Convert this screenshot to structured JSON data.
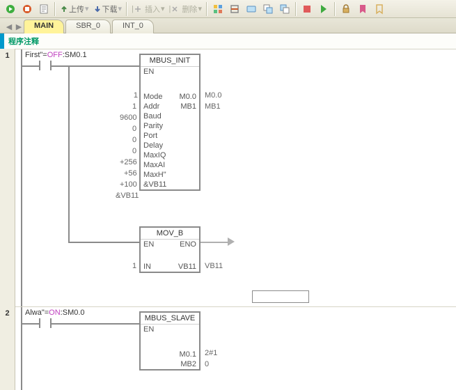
{
  "toolbar": {
    "upload_label": "上传",
    "download_label": "下载",
    "insert_label": "插入",
    "delete_label": "删除"
  },
  "tabs": {
    "main": "MAIN",
    "sbr0": "SBR_0",
    "int0": "INT_0"
  },
  "comment": "程序注释",
  "net1": {
    "number": "1",
    "label_first": "First\"=",
    "label_off": "OFF",
    "label_sm01": ":SM0.1",
    "mbus_init": {
      "title": "MBUS_INIT",
      "en": "EN",
      "pins": {
        "mode": "Mode",
        "mode_in": "1",
        "mode_out": "M0.0",
        "mode_ext": "M0.0",
        "addr": "Addr",
        "addr_in": "1",
        "addr_out": "MB1",
        "addr_ext": "MB1",
        "baud": "Baud",
        "baud_in": "9600",
        "parity": "Parity",
        "parity_in": "0",
        "port": "Port",
        "port_in": "0",
        "delay": "Delay",
        "delay_in": "0",
        "maxiq": "MaxIQ",
        "maxiq_in": "+256",
        "maxai": "MaxAI",
        "maxai_in": "+56",
        "maxh": "MaxH\"",
        "maxh_in": "+100",
        "vb": "&VB11",
        "vb_in": "&VB11"
      }
    },
    "mov_b": {
      "title": "MOV_B",
      "en": "EN",
      "eno": "ENO",
      "in": "IN",
      "in_val": "1",
      "out": "VB11",
      "out_ext": "VB11"
    }
  },
  "net2": {
    "number": "2",
    "label_always": "Alwa\"=",
    "label_on": "ON",
    "label_sm00": ":SM0.0",
    "mbus_slave": {
      "title": "MBUS_SLAVE",
      "en": "EN",
      "m01": "M0.1",
      "m01_out": "2#1",
      "mb2": "MB2",
      "mb2_out": "0"
    }
  }
}
